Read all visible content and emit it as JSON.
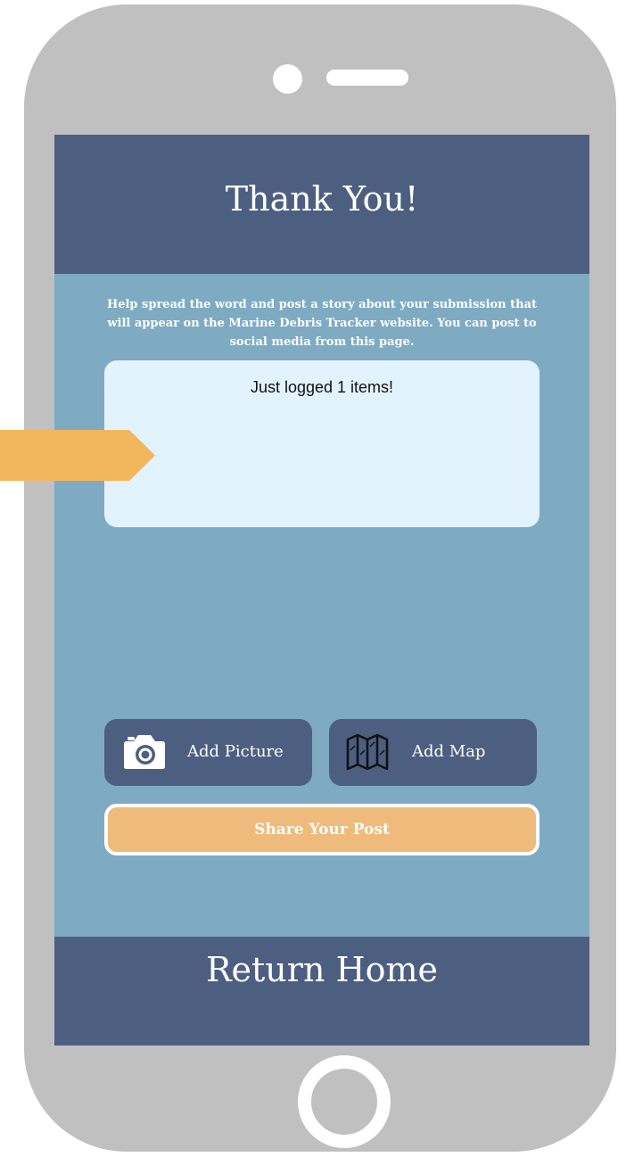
{
  "header": {
    "title": "Thank You!"
  },
  "content": {
    "help_text": "Help spread the word and post a story about your submission that will appear on the Marine Debris Tracker website.  You can post to social media from this page.",
    "post_text": "Just logged 1 items!"
  },
  "actions": {
    "add_picture_label": "Add Picture",
    "add_map_label": "Add Map",
    "share_label": "Share Your Post"
  },
  "footer": {
    "return_home_label": "Return Home"
  },
  "icons": {
    "camera": "camera-icon",
    "map": "map-icon",
    "arrow": "arrow-right-icon"
  },
  "colors": {
    "header_bar": "#4d5f80",
    "content_background": "#7eabc2",
    "post_box_background": "#e3f3fd",
    "share_button": "#efbb7d",
    "annotation_arrow": "#f4b65c",
    "phone_frame": "#c0c0c0"
  }
}
